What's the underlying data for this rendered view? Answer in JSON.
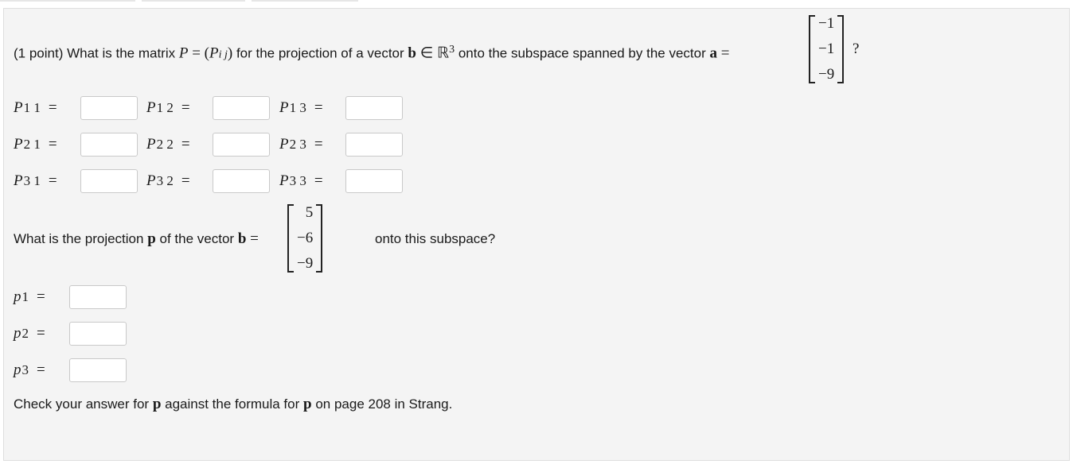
{
  "question1": {
    "prefix": "(1 point) What is the matrix",
    "P": "P",
    "equals": "=",
    "Pij_open": "(",
    "Pij_P": "P",
    "Pij_sub": "i j",
    "Pij_close": ")",
    "mid": "for the projection of a vector",
    "b": "b",
    "in": "∈",
    "R": "ℝ",
    "R_sup": "3",
    "mid2": "onto the subspace spanned by the vector",
    "a": "a",
    "a_equals": "=",
    "vector_a": [
      "−1",
      "−1",
      "−9"
    ],
    "suffix": "?"
  },
  "matrix_inputs": [
    [
      {
        "label": "P",
        "sub": "1 1",
        "eq": "="
      },
      {
        "label": "P",
        "sub": "1 2",
        "eq": "="
      },
      {
        "label": "P",
        "sub": "1 3",
        "eq": "="
      }
    ],
    [
      {
        "label": "P",
        "sub": "2 1",
        "eq": "="
      },
      {
        "label": "P",
        "sub": "2 2",
        "eq": "="
      },
      {
        "label": "P",
        "sub": "2 3",
        "eq": "="
      }
    ],
    [
      {
        "label": "P",
        "sub": "3 1",
        "eq": "="
      },
      {
        "label": "P",
        "sub": "3 2",
        "eq": "="
      },
      {
        "label": "P",
        "sub": "3 3",
        "eq": "="
      }
    ]
  ],
  "question2": {
    "prefix": "What is the projection",
    "p": "p",
    "mid": "of the vector",
    "b": "b",
    "equals": "=",
    "vector_b": [
      "5",
      "−6",
      "−9"
    ],
    "suffix": "onto this subspace?"
  },
  "projection_inputs": [
    {
      "label": "p",
      "sub": "1",
      "eq": "="
    },
    {
      "label": "p",
      "sub": "2",
      "eq": "="
    },
    {
      "label": "p",
      "sub": "3",
      "eq": "="
    }
  ],
  "footer": {
    "prefix": "Check your answer for",
    "p1": "p",
    "mid": "against the formula for",
    "p2": "p",
    "suffix": "on page 208 in Strang."
  }
}
